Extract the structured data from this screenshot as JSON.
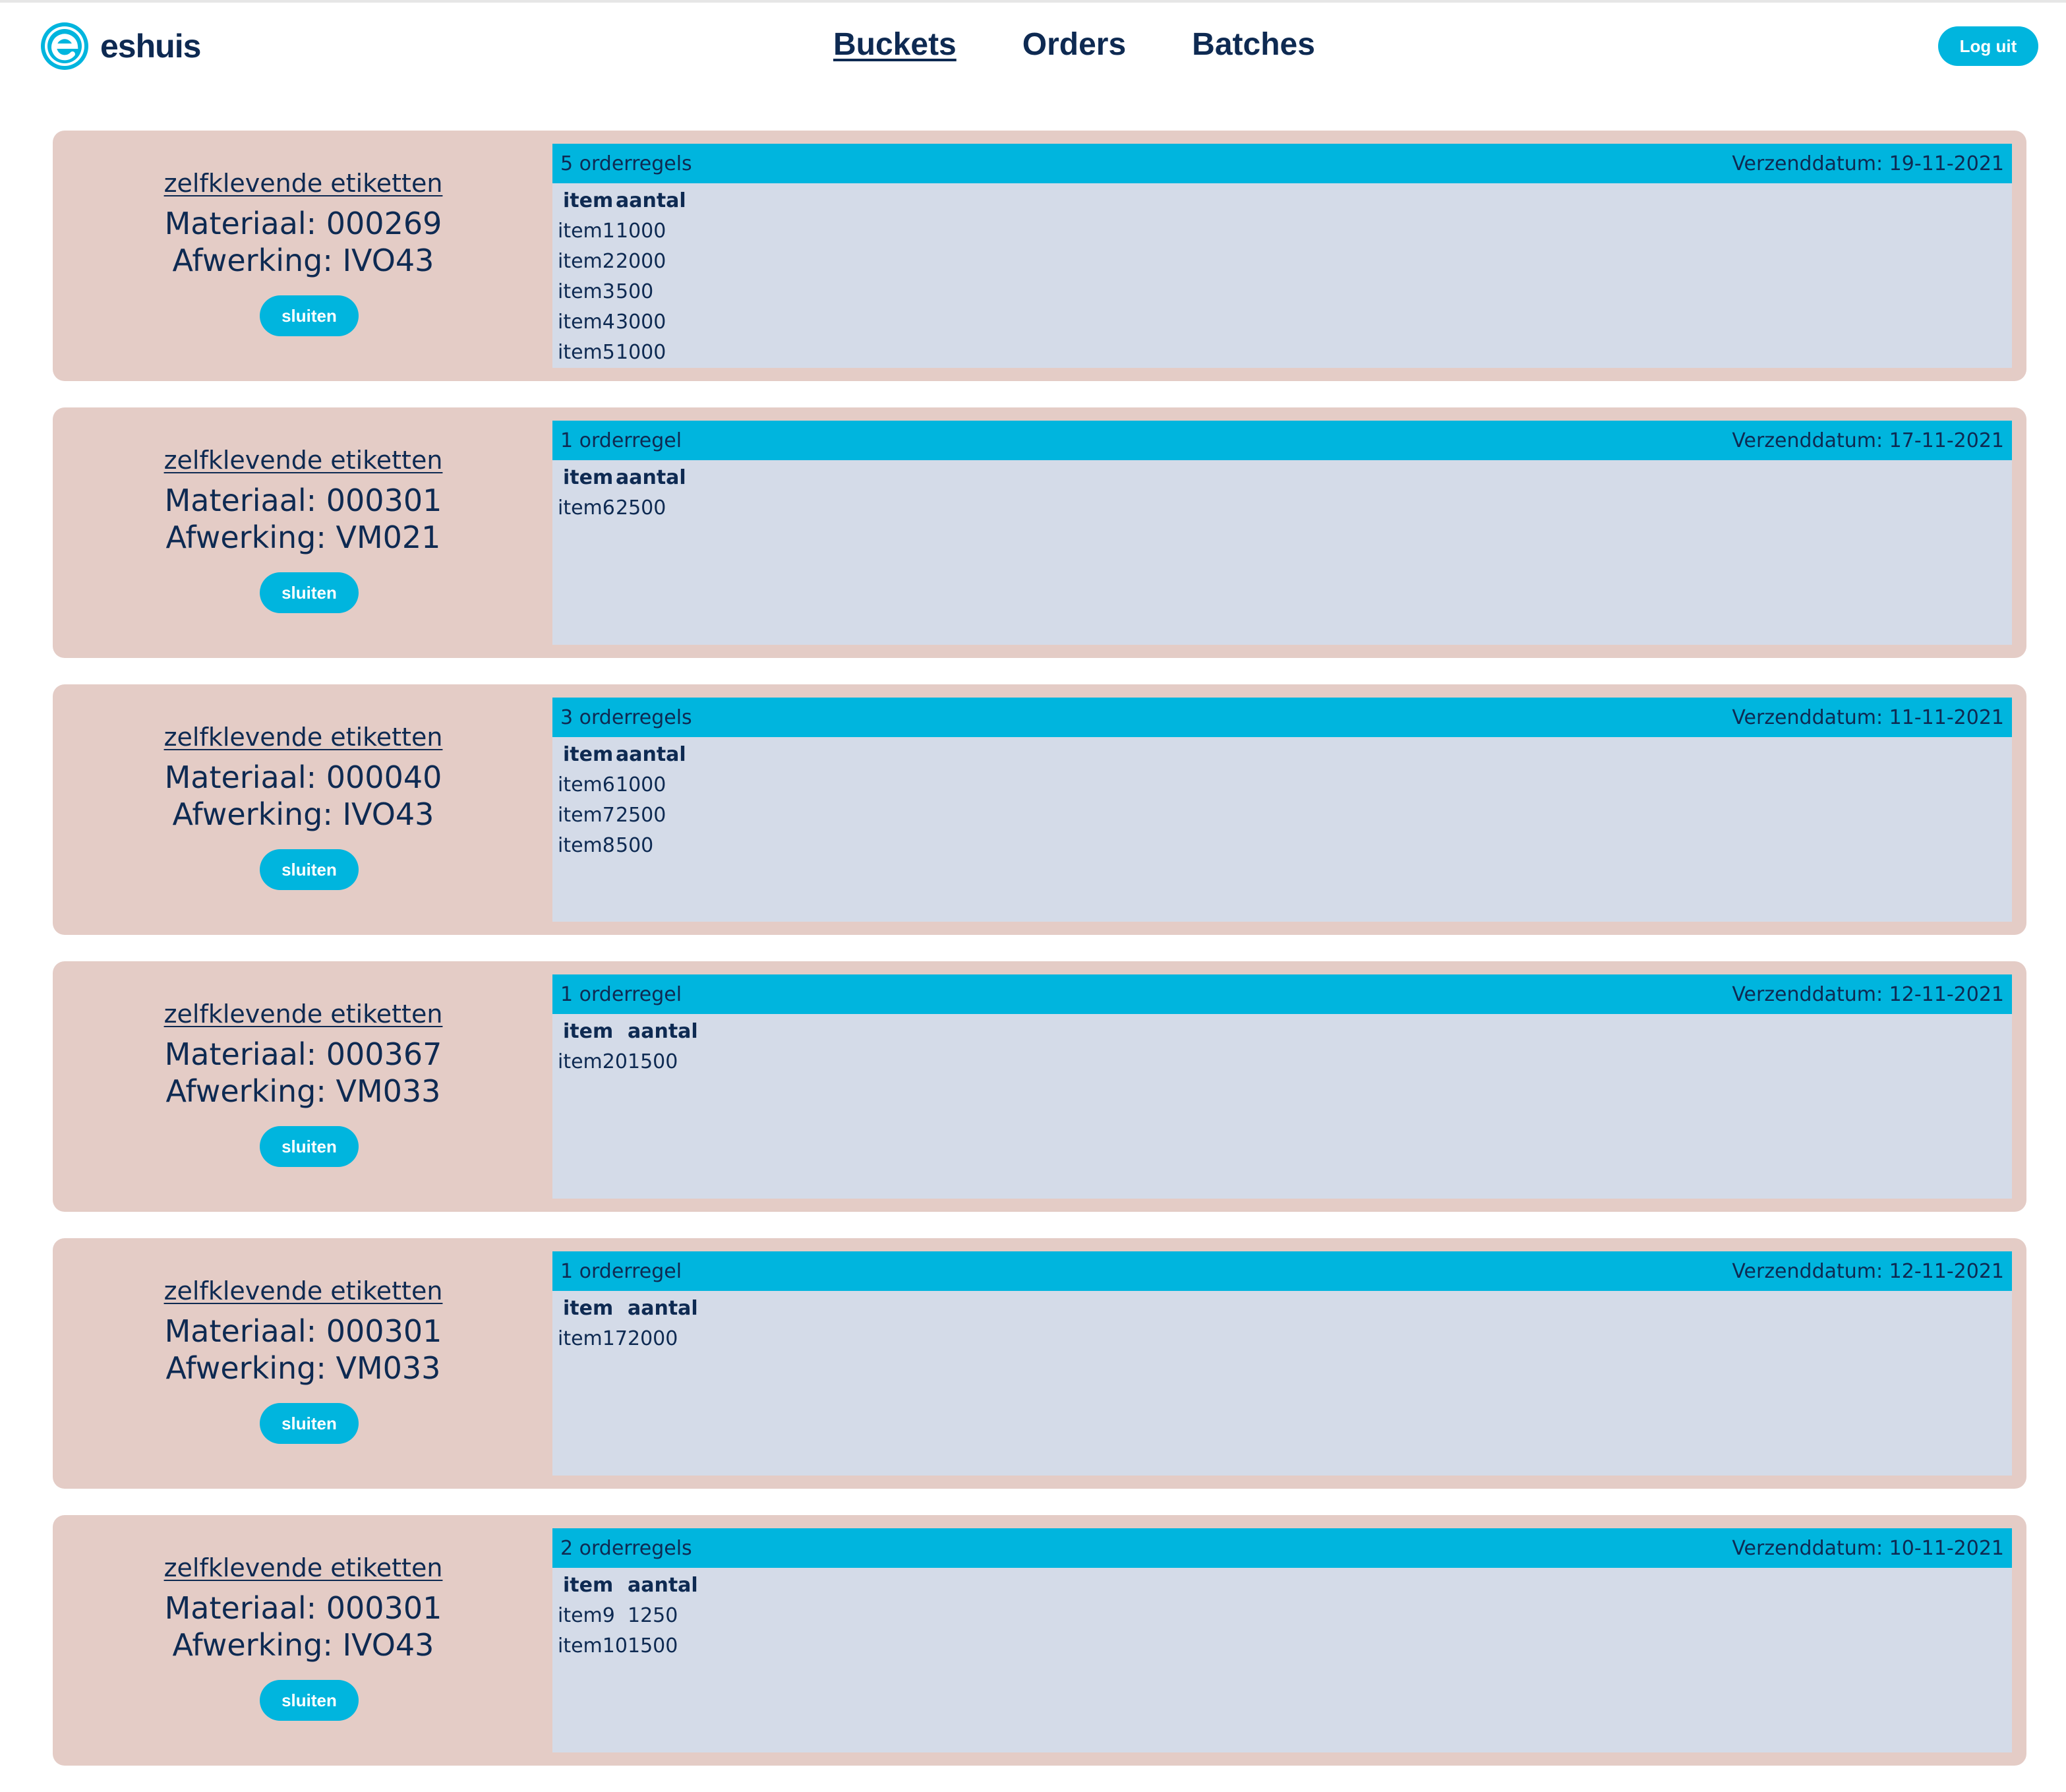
{
  "brand": {
    "name": "eshuis"
  },
  "nav": {
    "buckets": "Buckets",
    "orders": "Orders",
    "batches": "Batches"
  },
  "logout_label": "Log uit",
  "close_label": "sluiten",
  "table_headers": {
    "item": "item",
    "aantal": "aantal"
  },
  "cards": [
    {
      "category": "zelfklevende etiketten",
      "material": "Materiaal: 000269",
      "finish": "Afwerking: IVO43",
      "count": "5 orderregels",
      "date": "Verzenddatum: 19-11-2021",
      "rows": [
        {
          "item": "item1",
          "aantal": "1000"
        },
        {
          "item": "item2",
          "aantal": "2000"
        },
        {
          "item": "item3",
          "aantal": "500"
        },
        {
          "item": "item4",
          "aantal": "3000"
        },
        {
          "item": "item5",
          "aantal": "1000"
        }
      ]
    },
    {
      "category": "zelfklevende etiketten",
      "material": "Materiaal: 000301",
      "finish": "Afwerking: VM021",
      "count": "1 orderregel",
      "date": "Verzenddatum: 17-11-2021",
      "rows": [
        {
          "item": "item6",
          "aantal": "2500"
        }
      ]
    },
    {
      "category": "zelfklevende etiketten",
      "material": "Materiaal: 000040",
      "finish": "Afwerking: IVO43",
      "count": "3 orderregels",
      "date": "Verzenddatum: 11-11-2021",
      "rows": [
        {
          "item": "item6",
          "aantal": "1000"
        },
        {
          "item": "item7",
          "aantal": "2500"
        },
        {
          "item": "item8",
          "aantal": "500"
        }
      ]
    },
    {
      "category": "zelfklevende etiketten",
      "material": "Materiaal: 000367",
      "finish": "Afwerking: VM033",
      "count": "1 orderregel",
      "date": "Verzenddatum: 12-11-2021",
      "rows": [
        {
          "item": "item20",
          "aantal": "1500"
        }
      ]
    },
    {
      "category": "zelfklevende etiketten",
      "material": "Materiaal: 000301",
      "finish": "Afwerking: VM033",
      "count": "1 orderregel",
      "date": "Verzenddatum: 12-11-2021",
      "rows": [
        {
          "item": "item17",
          "aantal": "2000"
        }
      ]
    },
    {
      "category": "zelfklevende etiketten",
      "material": "Materiaal: 000301",
      "finish": "Afwerking: IVO43",
      "count": "2 orderregels",
      "date": "Verzenddatum: 10-11-2021",
      "rows": [
        {
          "item": "item9",
          "aantal": "1250"
        },
        {
          "item": "item10",
          "aantal": "1500"
        }
      ]
    }
  ],
  "colors": {
    "accent": "#00b5de",
    "navy": "#0e2a52",
    "card_bg": "#e4ccc6",
    "panel_bg": "#d4dbe8"
  }
}
